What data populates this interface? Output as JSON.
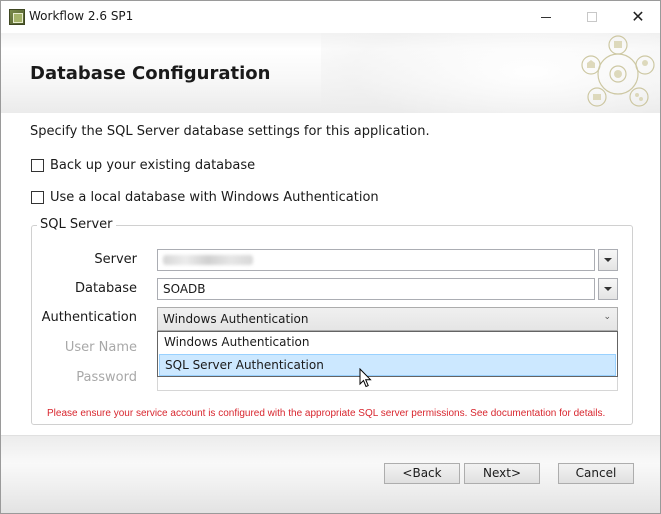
{
  "window": {
    "title": "Workflow 2.6 SP1",
    "icon": "app-icon",
    "controls": {
      "minimize": "minimize-icon",
      "maximize": "maximize-icon",
      "close": "close-icon"
    }
  },
  "header": {
    "title": "Database Configuration",
    "logo_icon": "product-network-logo"
  },
  "intro": "Specify the SQL Server database settings for this application.",
  "options": {
    "backup_label": "Back up your existing database",
    "backup_checked": false,
    "local_db_label": "Use a local database with Windows Authentication",
    "local_db_checked": false
  },
  "sql_server": {
    "group_label": "SQL Server",
    "server_label": "Server",
    "server_value": "",
    "database_label": "Database",
    "database_value": "SOADB",
    "authentication_label": "Authentication",
    "authentication_value": "Windows Authentication",
    "authentication_options": [
      "Windows Authentication",
      "SQL Server Authentication"
    ],
    "highlighted_option": "SQL Server Authentication",
    "username_label": "User Name",
    "password_label": "Password"
  },
  "warning": "Please ensure your service account is configured with the appropriate SQL server permissions. See documentation for details.",
  "buttons": {
    "back": "<Back",
    "next": "Next>",
    "cancel": "Cancel"
  },
  "colors": {
    "warning": "#d8262e",
    "selection": "#cce8ff",
    "disabled_label": "#a8a8a8"
  }
}
